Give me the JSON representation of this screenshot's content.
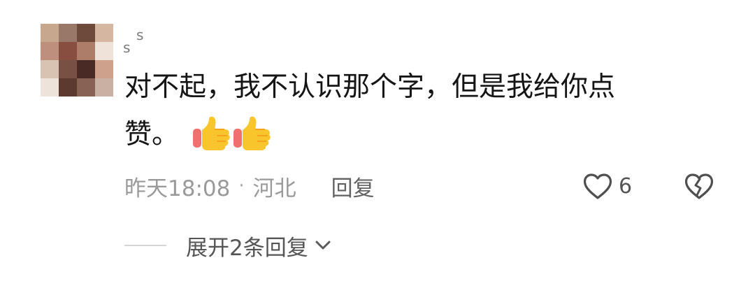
{
  "avatar": {
    "icon": "avatar",
    "colors": [
      "#c8a78c",
      "#9a7868",
      "#6f4a3b",
      "#d5b6a0",
      "#bf8f7b",
      "#8a4d3f",
      "#b07d67",
      "#f0e2d8",
      "#d9c3b2",
      "#7a5143",
      "#4a2a24",
      "#cfa18a",
      "#eee3da",
      "#5d3a2f",
      "#8a6254",
      "#c9b1a2"
    ]
  },
  "user": {
    "name": "s s",
    "name_part_1": "s",
    "name_part_2": "s"
  },
  "comment": {
    "line1": "对不起，我不认识那个字，但是我给你点",
    "line2": "赞。",
    "emoji_icon": "thumbs-up-icon",
    "emoji_count": 2
  },
  "meta": {
    "time": "昨天18:08",
    "separator": "·",
    "location": "河北",
    "reply": "回复"
  },
  "actions": {
    "like_icon": "heart-icon",
    "like_count": "6",
    "dislike_icon": "broken-heart-icon"
  },
  "replies": {
    "expand_text": "展开2条回复",
    "chevron_icon": "chevron-down-icon"
  },
  "colors": {
    "primary_text": "#151515",
    "secondary_text": "#9a9a9a",
    "reply_text": "#626262",
    "divider": "#d5d5d5"
  }
}
